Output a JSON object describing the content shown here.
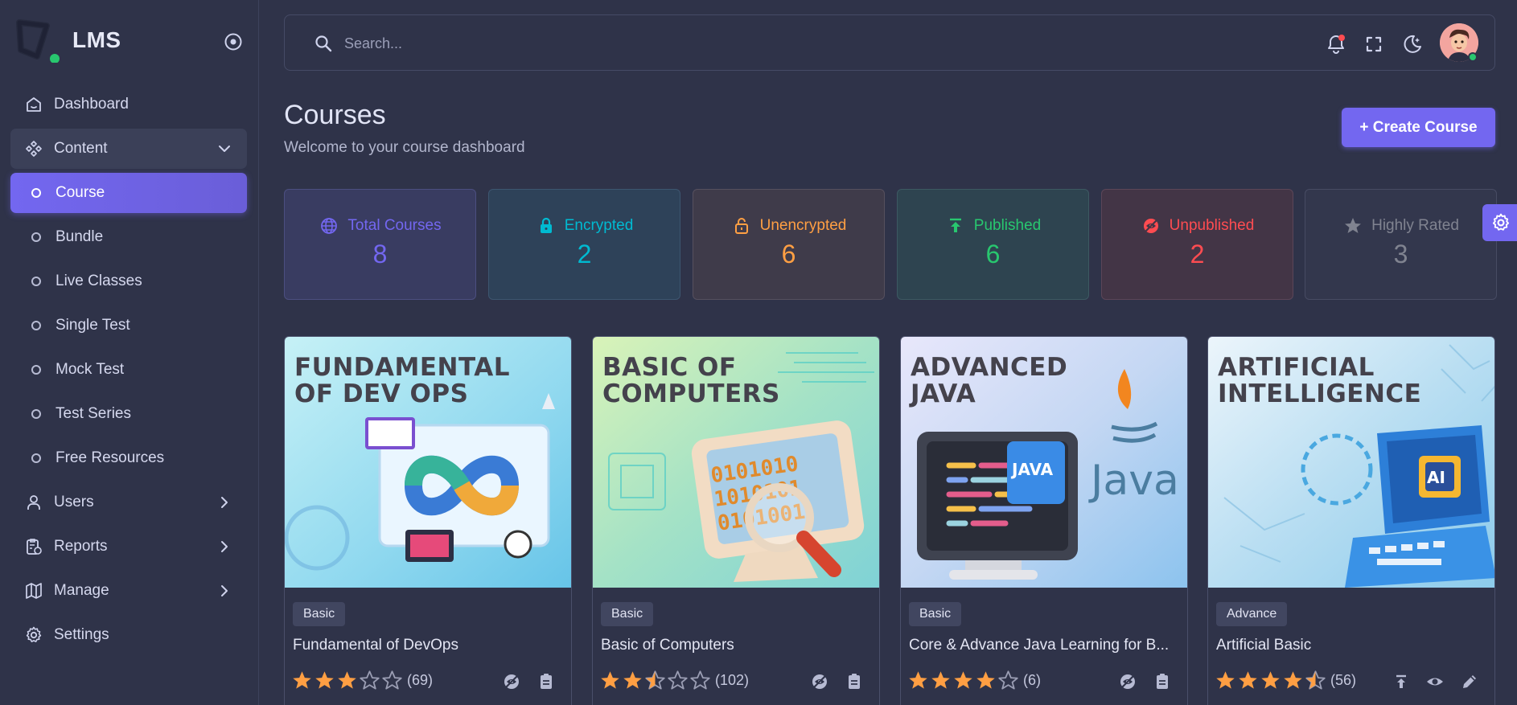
{
  "brand": {
    "name": "LMS"
  },
  "sidebar": {
    "items": [
      {
        "label": "Dashboard"
      },
      {
        "label": "Content"
      },
      {
        "label": "Course"
      },
      {
        "label": "Bundle"
      },
      {
        "label": "Live Classes"
      },
      {
        "label": "Single Test"
      },
      {
        "label": "Mock Test"
      },
      {
        "label": "Test Series"
      },
      {
        "label": "Free Resources"
      },
      {
        "label": "Users"
      },
      {
        "label": "Reports"
      },
      {
        "label": "Manage"
      },
      {
        "label": "Settings"
      }
    ]
  },
  "header": {
    "search_placeholder": "Search..."
  },
  "page": {
    "title": "Courses",
    "subtitle": "Welcome to your course dashboard",
    "create_label": "+ Create Course"
  },
  "stats": [
    {
      "label": "Total Courses",
      "value": "8",
      "color": "#7367f0"
    },
    {
      "label": "Encrypted",
      "value": "2",
      "color": "#00bad1"
    },
    {
      "label": "Unencrypted",
      "value": "6",
      "color": "#ff9f43"
    },
    {
      "label": "Published",
      "value": "6",
      "color": "#28c76f"
    },
    {
      "label": "Unpublished",
      "value": "2",
      "color": "#ff4c51"
    },
    {
      "label": "Highly Rated",
      "value": "3",
      "color": "#808390"
    }
  ],
  "courses": [
    {
      "thumb_line1": "FUNDAMENTAL",
      "thumb_line2": "OF DEV OPS",
      "level": "Basic",
      "name": "Fundamental of DevOps",
      "rating": 3,
      "reviews": "(69)"
    },
    {
      "thumb_line1": "BASIC OF",
      "thumb_line2": "COMPUTERS",
      "level": "Basic",
      "name": "Basic of Computers",
      "rating": 2.5,
      "reviews": "(102)"
    },
    {
      "thumb_line1": "ADVANCED",
      "thumb_line2": "JAVA",
      "thumb_extra": "JAVA",
      "thumb_logo": "Java",
      "level": "Basic",
      "name": "Core & Advance Java Learning for B...",
      "rating": 4,
      "reviews": "(6)"
    },
    {
      "thumb_line1": "ARTIFICIAL",
      "thumb_line2": "INTELLIGENCE",
      "thumb_extra": "AI",
      "level": "Advance",
      "name": "Artificial Basic",
      "rating": 4.5,
      "reviews": "(56)"
    }
  ],
  "colors": {
    "accent": "#7367f0",
    "star": "#ff9f43",
    "online": "#28c76f"
  }
}
